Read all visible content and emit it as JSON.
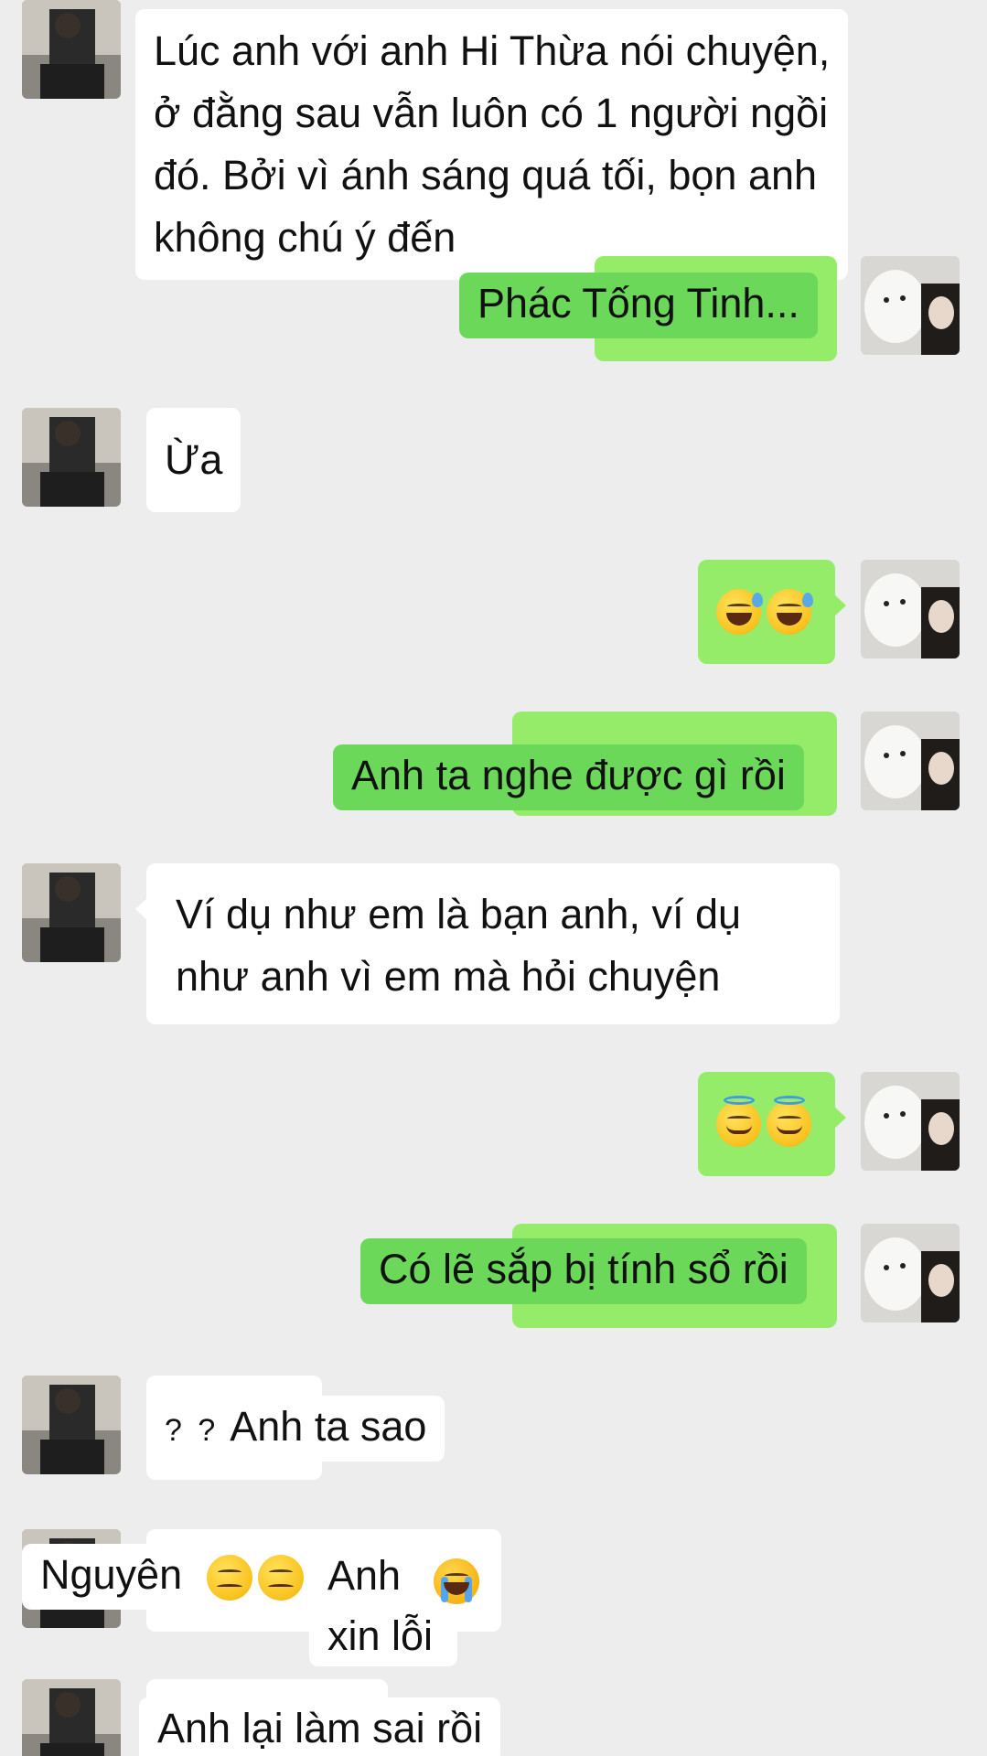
{
  "messages": {
    "m1": {
      "line1": "Lúc anh với anh Hi Thừa nói chuyện,",
      "line2": "ở đằng sau vẫn luôn có 1 người ngồi",
      "line3": "đó. Bởi vì ánh sáng quá tối, bọn anh",
      "line4": "không chú ý đến"
    },
    "m2": {
      "text": "Phác Tống Tinh..."
    },
    "m3": {
      "text": "Ừa"
    },
    "m4": {
      "emoji": "sweat-smile-emoji x2"
    },
    "m5": {
      "text": "Anh ta nghe được gì rồi"
    },
    "m6": {
      "line1": "Ví dụ như em là bạn anh, ví dụ",
      "line2": "như anh vì em mà hỏi chuyện"
    },
    "m7": {
      "emoji": "halo-smile-emoji x2"
    },
    "m8": {
      "text": "Có lẽ sắp bị tính sổ rồi"
    },
    "m9": {
      "prefix": "? ?",
      "text": "Anh ta sao"
    },
    "m10": {
      "name": "Nguyên",
      "word1": "Anh",
      "word2": "xin lỗi",
      "emoji": "pensive-emoji x2, crying-emoji"
    },
    "m11": {
      "text": "Anh lại làm sai rồi"
    }
  },
  "colors": {
    "background": "#ededed",
    "sent_bubble": "#95ec69",
    "received_bubble": "#ffffff"
  },
  "avatars": {
    "contact": "man-mirror-selfie-avatar",
    "self": "dog-and-person-avatar"
  }
}
